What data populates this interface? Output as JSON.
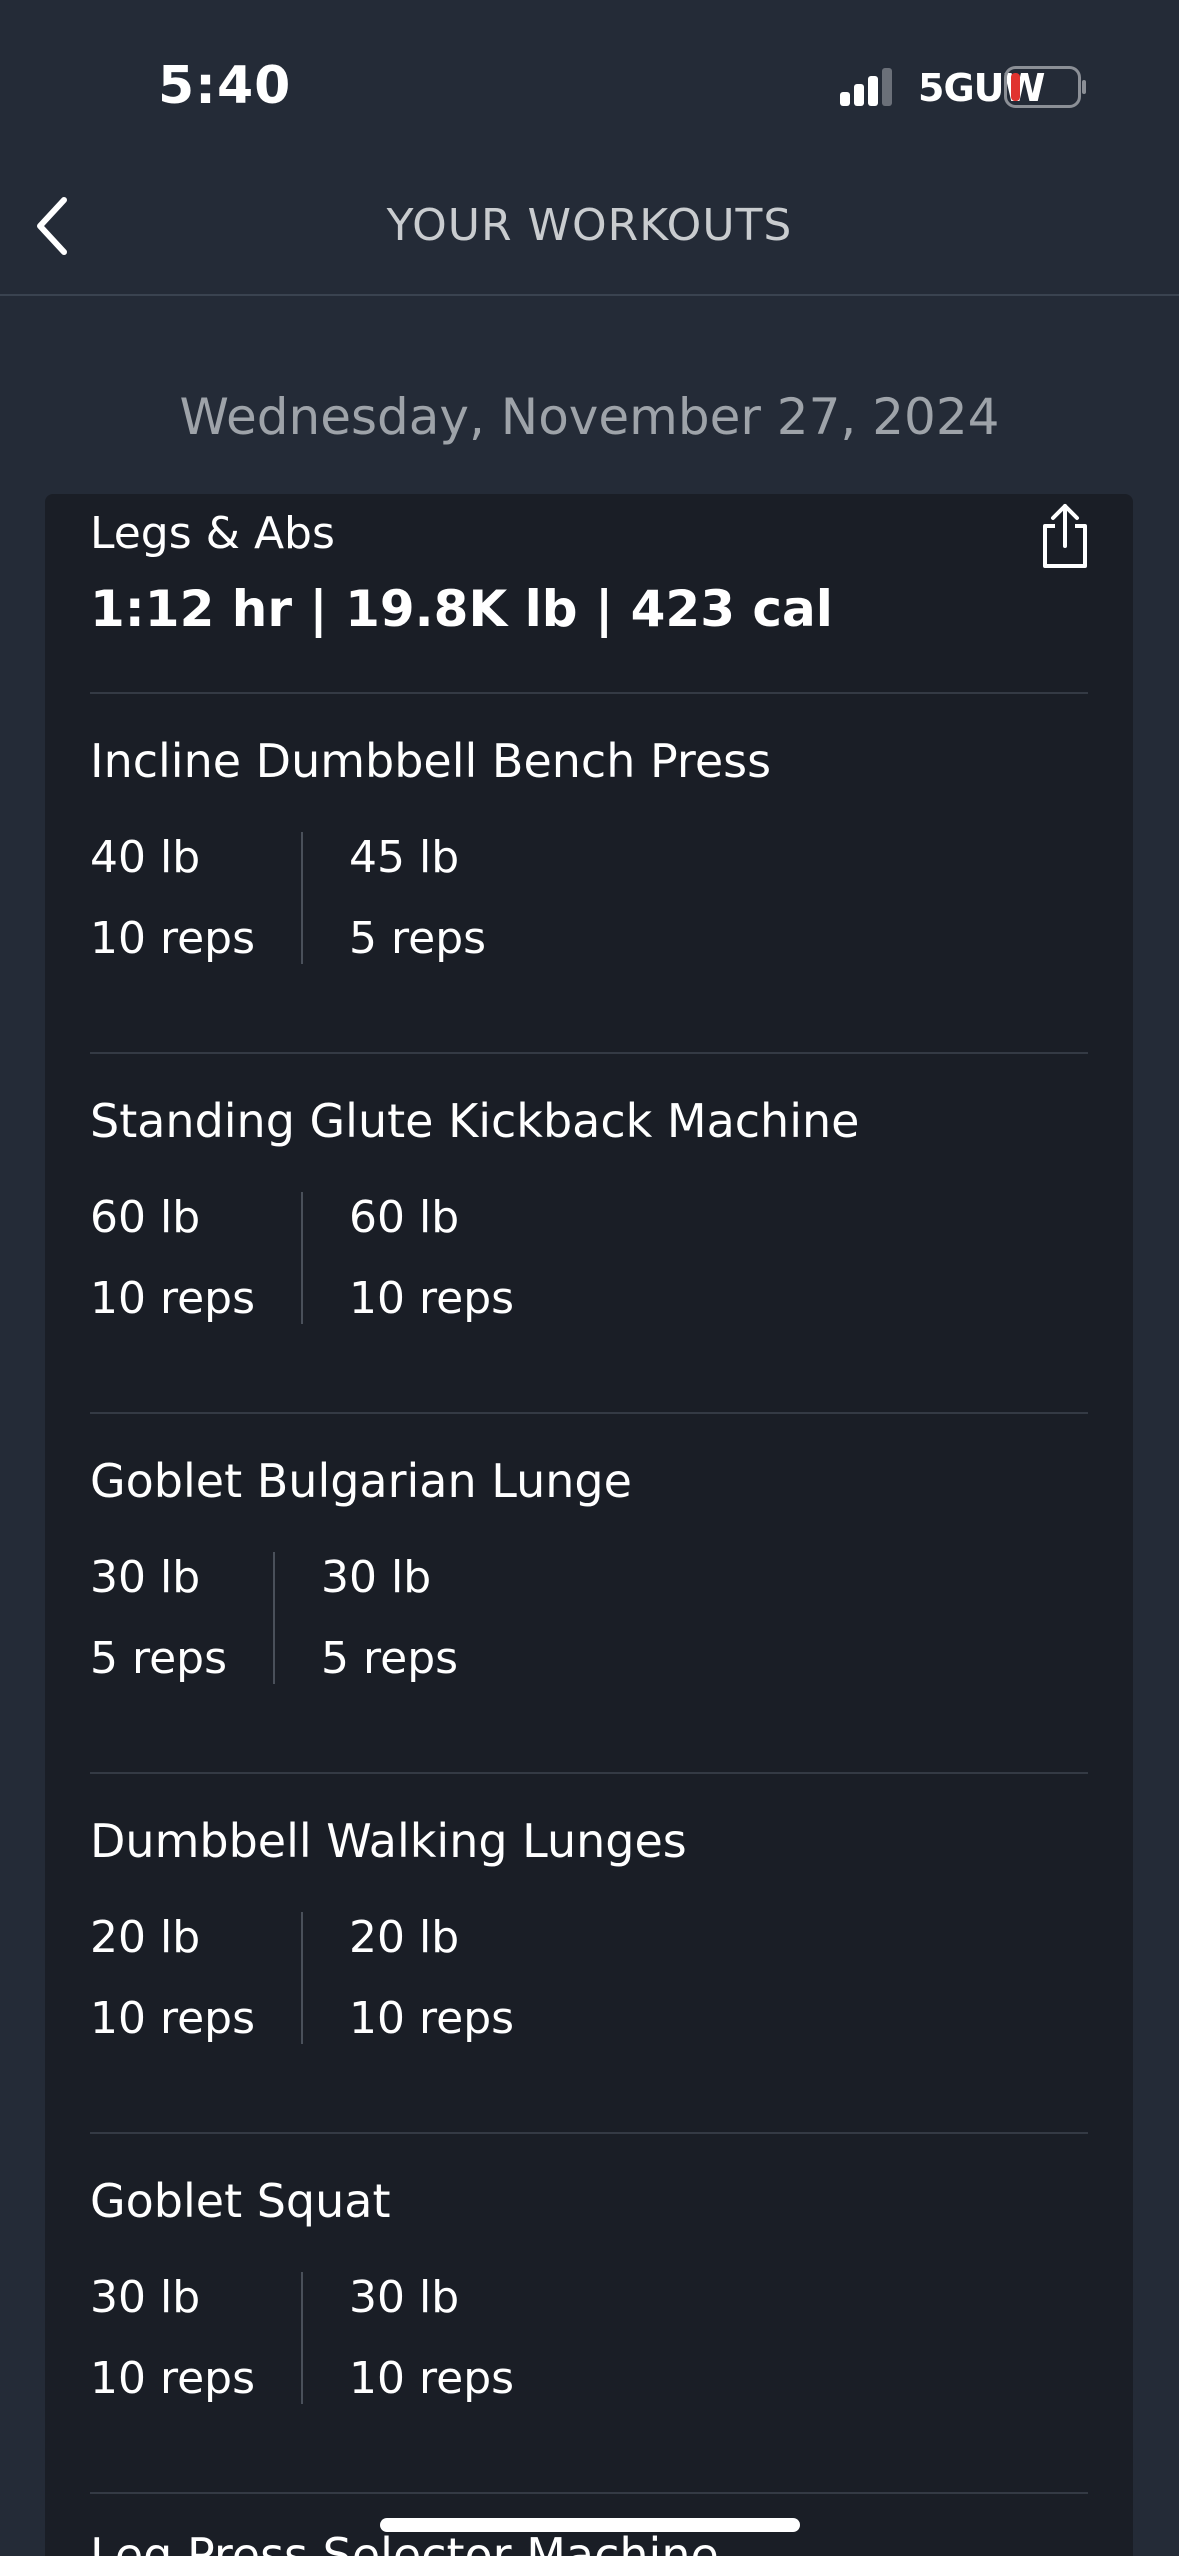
{
  "status_bar": {
    "time": "5:40",
    "network": "5GUW",
    "battery_color": "#e0332f"
  },
  "nav": {
    "title": "YOUR WORKOUTS",
    "back_icon": "chevron-left-icon"
  },
  "date": "Wednesday, November 27, 2024",
  "workout": {
    "name": "Legs & Abs",
    "summary": "1:12 hr | 19.8K lb | 423 cal",
    "share_icon": "share-icon"
  },
  "exercises": [
    {
      "name": "Incline Dumbbell Bench Press",
      "sets": [
        {
          "weight": "40 lb",
          "reps": "10 reps"
        },
        {
          "weight": "45 lb",
          "reps": "5 reps"
        }
      ]
    },
    {
      "name": "Standing Glute Kickback Machine",
      "sets": [
        {
          "weight": "60 lb",
          "reps": "10 reps"
        },
        {
          "weight": "60 lb",
          "reps": "10 reps"
        }
      ]
    },
    {
      "name": "Goblet Bulgarian Lunge",
      "sets": [
        {
          "weight": "30 lb",
          "reps": "5 reps"
        },
        {
          "weight": "30 lb",
          "reps": "5 reps"
        }
      ]
    },
    {
      "name": "Dumbbell Walking Lunges",
      "sets": [
        {
          "weight": "20 lb",
          "reps": "10 reps"
        },
        {
          "weight": "20 lb",
          "reps": "10 reps"
        }
      ]
    },
    {
      "name": "Goblet Squat",
      "sets": [
        {
          "weight": "30 lb",
          "reps": "10 reps"
        },
        {
          "weight": "30 lb",
          "reps": "10 reps"
        }
      ]
    },
    {
      "name": "Leg Press Selector Machine",
      "sets": []
    }
  ]
}
